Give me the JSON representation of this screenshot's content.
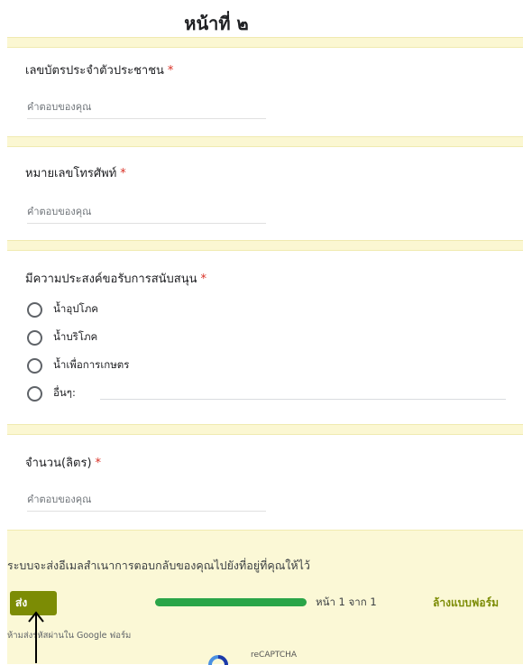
{
  "page": {
    "title": "หน้าที่ ๒"
  },
  "questions": {
    "id_card": {
      "label": "เลขบัตรประจำตัวประชาชน",
      "required_mark": "*",
      "placeholder": "คำตอบของคุณ"
    },
    "phone": {
      "label": "หมายเลขโทรศัพท์",
      "required_mark": "*",
      "placeholder": "คำตอบของคุณ"
    },
    "support": {
      "label": "มีความประสงค์ขอรับการสนับสนุน",
      "required_mark": "*",
      "options": [
        "น้ำอุปโภค",
        "น้ำบริโภค",
        "น้ำเพื่อการเกษตร",
        "อื่นๆ:"
      ]
    },
    "amount": {
      "label": "จำนวน(ลิตร)",
      "required_mark": "*",
      "placeholder": "คำตอบของคุณ"
    }
  },
  "footer": {
    "notice": "ระบบจะส่งอีเมลสำเนาการตอบกลับของคุณไปยังที่อยู่ที่คุณให้ไว้",
    "submit_label": "ส่ง",
    "progress": 1.0,
    "page_count": "หน้า 1 จาก 1",
    "clear_label": "ล้างแบบฟอร์ม",
    "never_submit": "ห้ามส่งรหัสผ่านใน Google ฟอร์ม",
    "recaptcha": "reCAPTCHA"
  },
  "colors": {
    "accent": "#7c8c05",
    "progress": "#2aa548",
    "section_band": "#fbf7d2",
    "required": "#d93025"
  }
}
